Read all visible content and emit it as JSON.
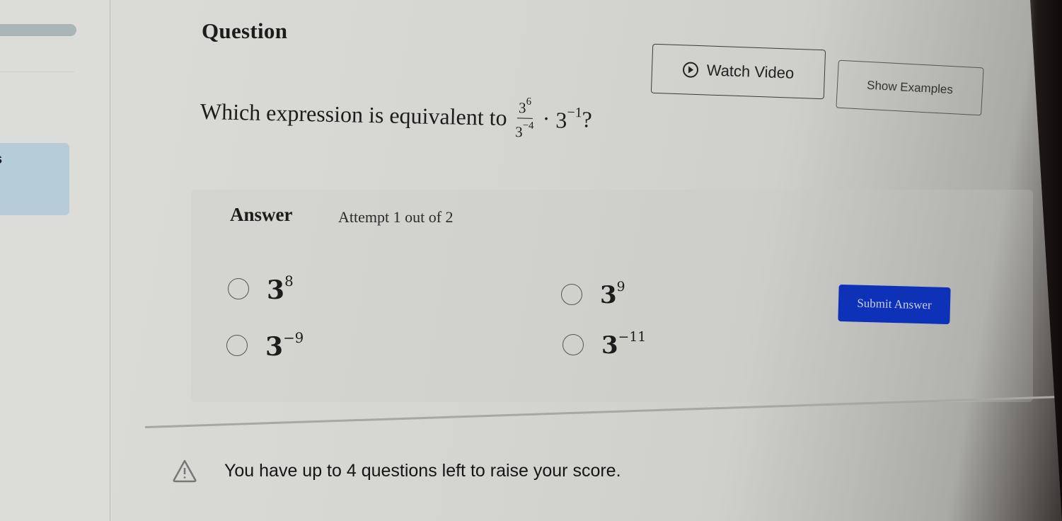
{
  "sidebar": {
    "active_item_label_fragment": "s"
  },
  "question": {
    "title": "Question",
    "prompt_prefix": "Which expression is equivalent to",
    "expression": {
      "fraction_numerator_base": "3",
      "fraction_numerator_exp": "6",
      "fraction_denominator_base": "3",
      "fraction_denominator_exp": "−4",
      "operator": "·",
      "factor_base": "3",
      "factor_exp": "−1",
      "suffix": "?"
    }
  },
  "toolbar": {
    "watch_video_label": "Watch Video",
    "show_examples_label": "Show Examples"
  },
  "answer": {
    "label": "Answer",
    "attempt_text": "Attempt 1 out of 2",
    "options": [
      {
        "base": "3",
        "exp": "8"
      },
      {
        "base": "3",
        "exp": "9"
      },
      {
        "base": "3",
        "exp": "−9"
      },
      {
        "base": "3",
        "exp": "−11"
      }
    ],
    "submit_label": "Submit Answer"
  },
  "notice": {
    "text": "You have up to 4 questions left to raise your score."
  },
  "colors": {
    "submit_bg": "#0d32b8",
    "sidebar_active_bg": "#b6ccd8"
  }
}
